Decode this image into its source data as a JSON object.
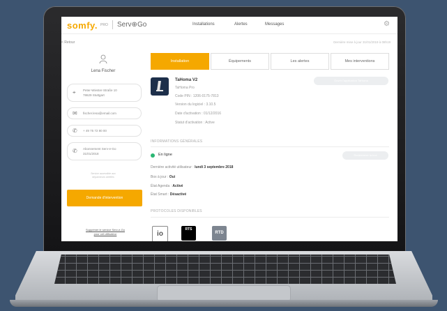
{
  "app": {
    "brand": "somfy.",
    "brand_suffix": "PRO",
    "product": "Serv⊕Go",
    "nav": [
      "Installations",
      "Alertes",
      "Messages"
    ]
  },
  "back_link": "< Retour",
  "last_update": "Dernière mise à jour 31/01/2019 à 08h19",
  "user": {
    "name": "Lena Fischer",
    "address_line1": "Peter-Wiester-Straße 10",
    "address_line2": "78629 Stuttgart",
    "email": "fischer.lena@email.com",
    "phone": "+ 49 75 72 80 00",
    "subscription_line1": "Abonnement Serv-e-Go",
    "subscription_line2": "31/01/2018",
    "note_line1": "Service accessible aux",
    "note_line2": "dépanneurs certifiés",
    "request_button": "Demande d'intervention",
    "delete_link_line1": "Supprimer le service Serv-e-Go",
    "delete_link_line2": "pour cet utilisateur"
  },
  "tabs": [
    "Installation",
    "Équipements",
    "Les alertes",
    "Mes interventions"
  ],
  "device": {
    "name": "TaHoma V2",
    "model": "TaHoma Pro",
    "pin": "Code PIN : 1206-0175-7813",
    "software": "Version du logiciel : 3.10.5",
    "activation_date": "Date d'activation : 01/12/2016",
    "activation_status": "Statut d'activation : Active",
    "action_button": "Ouvrir l'application TaHoma"
  },
  "general": {
    "title": "INFORMATIONS GÉNÉRALES",
    "status": "En ligne",
    "restart_button": "Redémarrer la box",
    "last_activity_label": "Dernière activité utilisateur :",
    "last_activity_value": "lundi 3 septembre 2018",
    "box_uptodate_label": "Box à jour :",
    "box_uptodate_value": "Oui",
    "agenda_label": "État Agenda :",
    "agenda_value": "Activé",
    "smart_label": "État Smart :",
    "smart_value": "Désactivé"
  },
  "protocols": {
    "title": "PROTOCOLES DISPONIBLES",
    "items": [
      "io",
      "RTS",
      "RTD"
    ]
  },
  "colors": {
    "accent": "#f5a800",
    "online": "#2bb673",
    "device_icon_bg": "#1d2f4a",
    "background": "#3d5470"
  }
}
